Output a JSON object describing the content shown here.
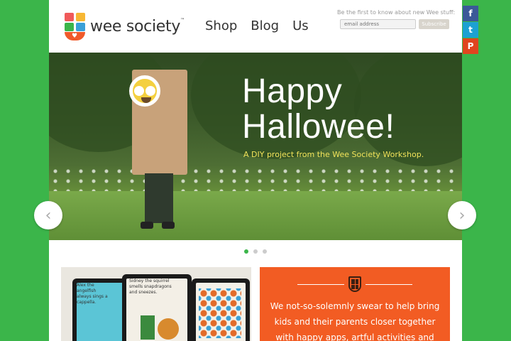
{
  "brand": {
    "name": "wee society",
    "tm": "™"
  },
  "nav": [
    {
      "label": "Shop"
    },
    {
      "label": "Blog"
    },
    {
      "label": "Us"
    }
  ],
  "signup": {
    "message": "Be the first to know about new Wee stuff:",
    "placeholder": "email address",
    "button": "Subscribe"
  },
  "hero": {
    "headline_line1": "Happy",
    "headline_line2": "Hallowee!",
    "tagline": "A DIY project from the Wee Society Workshop."
  },
  "carousel": {
    "prev": "‹",
    "next": "›",
    "slide_count": 3,
    "active_slide": 1
  },
  "promo": {
    "tablet1_text": "Alex the angelfish always sings a cappella.",
    "tablet2_text": "Sidney the squirrel smells snapdragons and sneezes."
  },
  "mission": {
    "copy": "We not-so-solemnly swear to help bring kids and their parents closer together with happy apps, artful activities and"
  },
  "social": {
    "facebook": "f",
    "twitter": "t",
    "pinterest": "P"
  },
  "colors": {
    "page_bg": "#3bb54a",
    "accent_orange": "#f25c23",
    "dot_active": "#3bb54a"
  }
}
